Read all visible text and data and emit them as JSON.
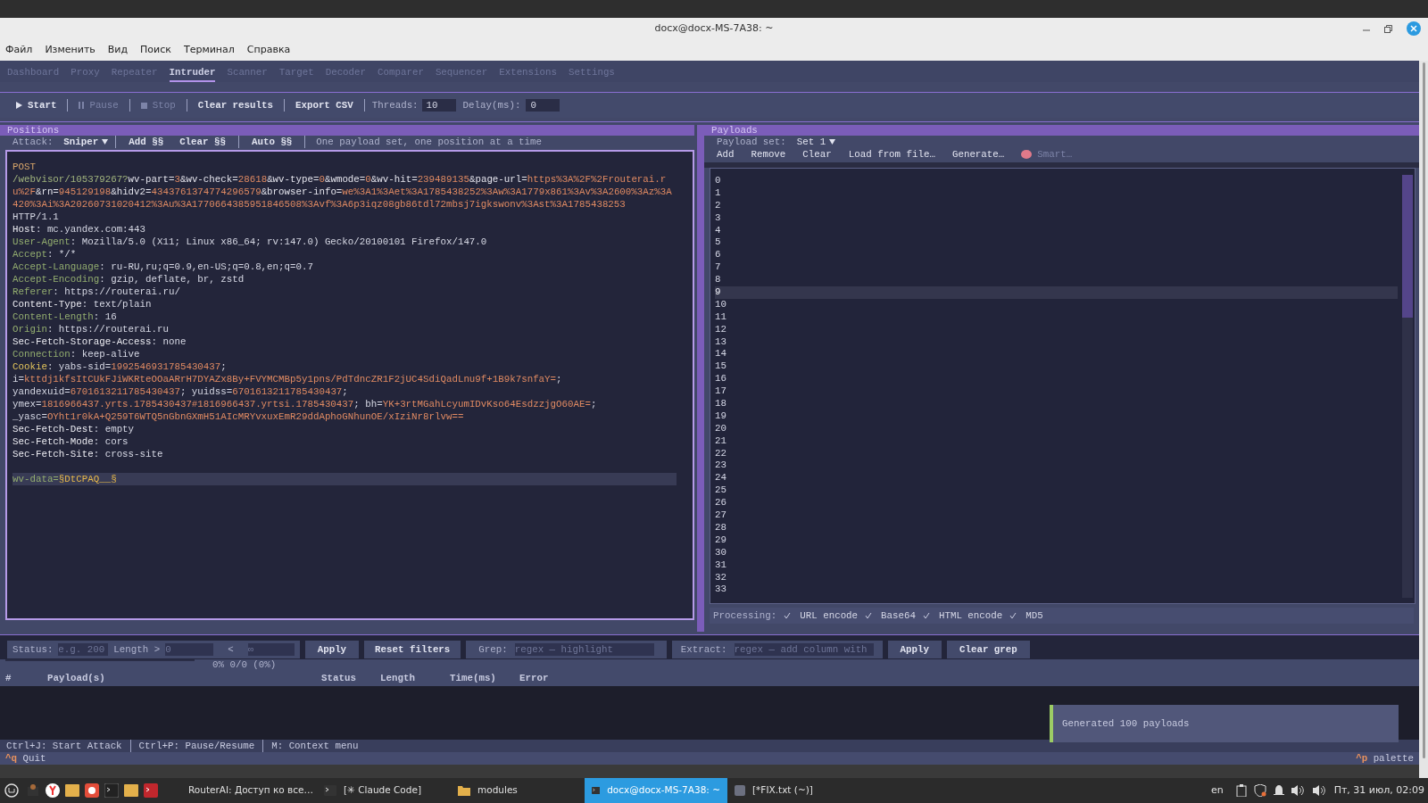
{
  "window": {
    "title": "docx@docx-MS-7A38: ~"
  },
  "menu": [
    "Файл",
    "Изменить",
    "Вид",
    "Поиск",
    "Терминал",
    "Справка"
  ],
  "tabs": [
    {
      "label": "Dashboard",
      "selected": false
    },
    {
      "label": "Proxy",
      "selected": false
    },
    {
      "label": "Repeater",
      "selected": false
    },
    {
      "label": "Intruder",
      "selected": true
    },
    {
      "label": "Scanner",
      "selected": false
    },
    {
      "label": "Target",
      "selected": false
    },
    {
      "label": "Decoder",
      "selected": false
    },
    {
      "label": "Comparer",
      "selected": false
    },
    {
      "label": "Sequencer",
      "selected": false
    },
    {
      "label": "Extensions",
      "selected": false
    },
    {
      "label": "Settings",
      "selected": false
    }
  ],
  "toolbar": {
    "buttons": [
      {
        "label": "Start",
        "kind": "play",
        "disabled": false
      },
      {
        "label": "Pause",
        "kind": "pause",
        "disabled": true
      },
      {
        "label": "Stop",
        "kind": "stop",
        "disabled": true
      },
      {
        "label": "Clear results",
        "disabled": false
      },
      {
        "label": "Export CSV",
        "disabled": false
      }
    ],
    "threads": {
      "label": "Threads:",
      "value": "10"
    },
    "delay": {
      "label": "Delay(ms):",
      "value": "0"
    }
  },
  "positions": {
    "title": "Positions",
    "attack_label": "Attack:",
    "attack_type": "Sniper",
    "buttons": [
      "Add §§",
      "Clear §§",
      "Auto §§"
    ],
    "hint": "One payload set, one position at a time",
    "lines": [
      {
        "current": false,
        "segments": [
          {
            "kind": "method",
            "text": "POST"
          }
        ]
      },
      {
        "current": false,
        "segments": [
          {
            "kind": "path",
            "text": "/webvisor/105379267?"
          },
          {
            "kind": "pname",
            "text": "wv-part="
          },
          {
            "kind": "pval",
            "text": "3"
          },
          {
            "kind": "pname",
            "text": "&wv-check="
          },
          {
            "kind": "pval",
            "text": "28618"
          },
          {
            "kind": "pname",
            "text": "&wv-type="
          },
          {
            "kind": "pval",
            "text": "0"
          },
          {
            "kind": "pname",
            "text": "&wmode="
          },
          {
            "kind": "pval",
            "text": "0"
          },
          {
            "kind": "pname",
            "text": "&wv-hit="
          },
          {
            "kind": "pval",
            "text": "239489135"
          },
          {
            "kind": "pname",
            "text": "&page-url="
          },
          {
            "kind": "pval",
            "text": "https%3A%2F%2Frouterai.ru%2F"
          },
          {
            "kind": "pname",
            "text": "&rn="
          },
          {
            "kind": "pval",
            "text": "945129198"
          },
          {
            "kind": "pname",
            "text": "&hidv2="
          },
          {
            "kind": "pval",
            "text": "4343761374774296579"
          },
          {
            "kind": "pname",
            "text": "&browser-info="
          },
          {
            "kind": "pval",
            "text": "we%3A1%3Aet%3A1785438252%3Aw%3A1779x861%3Av%3A2600%3Az%3A420%3Ai%3A20260731020412%3Au%3A1770664385951846508%3Avf%3A6p3iqz08gb86tdl72mbsj7igkswonv%3Ast%3A1785438253"
          }
        ]
      },
      {
        "current": false,
        "segments": [
          {
            "kind": "value",
            "text": "HTTP/1.1"
          }
        ]
      },
      {
        "current": false,
        "segments": [
          {
            "kind": "hname",
            "text": "Host"
          },
          {
            "kind": "value",
            "text": ": mc.yandex.com:443"
          }
        ]
      },
      {
        "current": false,
        "segments": [
          {
            "kind": "hstd",
            "text": "User-Agent"
          },
          {
            "kind": "value",
            "text": ": Mozilla/5.0 (X11; Linux x86_64; rv:147.0) Gecko/20100101 Firefox/147.0"
          }
        ]
      },
      {
        "current": false,
        "segments": [
          {
            "kind": "hstd",
            "text": "Accept"
          },
          {
            "kind": "value",
            "text": ": */*"
          }
        ]
      },
      {
        "current": false,
        "segments": [
          {
            "kind": "hstd",
            "text": "Accept-Language"
          },
          {
            "kind": "value",
            "text": ": ru-RU,ru;q=0.9,en-US;q=0.8,en;q=0.7"
          }
        ]
      },
      {
        "current": false,
        "segments": [
          {
            "kind": "hstd",
            "text": "Accept-Encoding"
          },
          {
            "kind": "value",
            "text": ": gzip, deflate, br, zstd"
          }
        ]
      },
      {
        "current": false,
        "segments": [
          {
            "kind": "hstd",
            "text": "Referer"
          },
          {
            "kind": "value",
            "text": ": https://routerai.ru/"
          }
        ]
      },
      {
        "current": false,
        "segments": [
          {
            "kind": "hname",
            "text": "Content-Type"
          },
          {
            "kind": "value",
            "text": ": text/plain"
          }
        ]
      },
      {
        "current": false,
        "segments": [
          {
            "kind": "hstd",
            "text": "Content-Length"
          },
          {
            "kind": "value",
            "text": ": 16"
          }
        ]
      },
      {
        "current": false,
        "segments": [
          {
            "kind": "hstd",
            "text": "Origin"
          },
          {
            "kind": "value",
            "text": ": https://routerai.ru"
          }
        ]
      },
      {
        "current": false,
        "segments": [
          {
            "kind": "hname",
            "text": "Sec-Fetch-Storage-Access"
          },
          {
            "kind": "value",
            "text": ": none"
          }
        ]
      },
      {
        "current": false,
        "segments": [
          {
            "kind": "hstd",
            "text": "Connection"
          },
          {
            "kind": "value",
            "text": ": keep-alive"
          }
        ]
      },
      {
        "current": false,
        "segments": [
          {
            "kind": "hcookie",
            "text": "Cookie"
          },
          {
            "kind": "value",
            "text": ": yabs-sid="
          },
          {
            "kind": "pval",
            "text": "1992546931785430437"
          },
          {
            "kind": "value",
            "text": ";"
          }
        ]
      },
      {
        "current": false,
        "segments": [
          {
            "kind": "value",
            "text": "i="
          },
          {
            "kind": "pval",
            "text": "kttdj1kfsItCUkFJiWKRteOOaARrH7DYAZx8By+FVYMCMBp5y1pns/PdTdncZR1F2jUC4SdiQadLnu9f+1B9k7snfaY="
          },
          {
            "kind": "value",
            "text": ";"
          }
        ]
      },
      {
        "current": false,
        "segments": [
          {
            "kind": "value",
            "text": "yandexuid="
          },
          {
            "kind": "pval",
            "text": "6701613211785430437"
          },
          {
            "kind": "value",
            "text": "; yuidss="
          },
          {
            "kind": "pval",
            "text": "6701613211785430437"
          },
          {
            "kind": "value",
            "text": ";"
          }
        ]
      },
      {
        "current": false,
        "segments": [
          {
            "kind": "value",
            "text": "ymex="
          },
          {
            "kind": "pval",
            "text": "1816966437.yrts.1785430437#1816966437.yrtsi.1785430437"
          },
          {
            "kind": "value",
            "text": "; bh="
          },
          {
            "kind": "pval",
            "text": "YK+3rtMGahLcyumIDvKso64EsdzzjgO60AE="
          },
          {
            "kind": "value",
            "text": ";"
          }
        ]
      },
      {
        "current": false,
        "segments": [
          {
            "kind": "value",
            "text": "_yasc="
          },
          {
            "kind": "pval",
            "text": "OYht1r0kA+Q259T6WTQ5nGbnGXmH51AIcMRYvxuxEmR29ddAphoGNhunOE/xIziNr8rlvw=="
          }
        ]
      },
      {
        "current": false,
        "segments": [
          {
            "kind": "hname",
            "text": "Sec-Fetch-Dest"
          },
          {
            "kind": "value",
            "text": ": empty"
          }
        ]
      },
      {
        "current": false,
        "segments": [
          {
            "kind": "hname",
            "text": "Sec-Fetch-Mode"
          },
          {
            "kind": "value",
            "text": ": cors"
          }
        ]
      },
      {
        "current": false,
        "segments": [
          {
            "kind": "hname",
            "text": "Sec-Fetch-Site"
          },
          {
            "kind": "value",
            "text": ": cross-site"
          }
        ]
      }
    ],
    "body": {
      "current": true,
      "segments": [
        {
          "kind": "hstd",
          "text": "wv-data="
        },
        {
          "kind": "marker",
          "text": "§DtCPAQ__§"
        }
      ]
    }
  },
  "payloads": {
    "title": "Payloads",
    "set_label": "Payload set:",
    "set_value": "Set 1",
    "actions": [
      {
        "label": "Add",
        "disabled": false
      },
      {
        "label": "Remove",
        "disabled": false
      },
      {
        "label": "Clear",
        "disabled": false
      },
      {
        "label": "Load from file…",
        "disabled": false
      },
      {
        "label": "Generate…",
        "disabled": false
      },
      {
        "label": "Smart…",
        "disabled": true,
        "kind": "brain"
      }
    ],
    "items": [
      {
        "label": "0",
        "selected": false
      },
      {
        "label": "1",
        "selected": false
      },
      {
        "label": "2",
        "selected": false
      },
      {
        "label": "3",
        "selected": false
      },
      {
        "label": "4",
        "selected": false
      },
      {
        "label": "5",
        "selected": false
      },
      {
        "label": "6",
        "selected": false
      },
      {
        "label": "7",
        "selected": false
      },
      {
        "label": "8",
        "selected": false
      },
      {
        "label": "9",
        "selected": true
      },
      {
        "label": "10",
        "selected": false
      },
      {
        "label": "11",
        "selected": false
      },
      {
        "label": "12",
        "selected": false
      },
      {
        "label": "13",
        "selected": false
      },
      {
        "label": "14",
        "selected": false
      },
      {
        "label": "15",
        "selected": false
      },
      {
        "label": "16",
        "selected": false
      },
      {
        "label": "17",
        "selected": false
      },
      {
        "label": "18",
        "selected": false
      },
      {
        "label": "19",
        "selected": false
      },
      {
        "label": "20",
        "selected": false
      },
      {
        "label": "21",
        "selected": false
      },
      {
        "label": "22",
        "selected": false
      },
      {
        "label": "23",
        "selected": false
      },
      {
        "label": "24",
        "selected": false
      },
      {
        "label": "25",
        "selected": false
      },
      {
        "label": "26",
        "selected": false
      },
      {
        "label": "27",
        "selected": false
      },
      {
        "label": "28",
        "selected": false
      },
      {
        "label": "29",
        "selected": false
      },
      {
        "label": "30",
        "selected": false
      },
      {
        "label": "31",
        "selected": false
      },
      {
        "label": "32",
        "selected": false
      },
      {
        "label": "33",
        "selected": false
      }
    ],
    "processing_label": "Processing:",
    "processing": [
      {
        "label": "URL encode",
        "checked": true
      },
      {
        "label": "Base64",
        "checked": true
      },
      {
        "label": "HTML encode",
        "checked": true
      },
      {
        "label": "MD5",
        "checked": true
      }
    ]
  },
  "filters": {
    "status_label": "Status:",
    "status_placeholder": "e.g. 200",
    "length_label": "Length >",
    "length_placeholder": "0",
    "lt_label": "<",
    "lt_placeholder": "∞",
    "apply": "Apply",
    "reset": "Reset filters",
    "grep_label": "Grep:",
    "grep_placeholder": "regex — highlight",
    "extract_label": "Extract:",
    "extract_placeholder": "regex — add column with",
    "apply2": "Apply",
    "clear_grep": "Clear grep"
  },
  "progress": {
    "level": 0,
    "text": "0% 0/0 (0%)"
  },
  "results": {
    "columns": [
      "#",
      "Payload(s)",
      "Status",
      "Length",
      "Time(ms)",
      "Error"
    ]
  },
  "shortcuts": [
    "Ctrl+J: Start Attack",
    "Ctrl+P: Pause/Resume",
    "M: Context menu"
  ],
  "footer": {
    "left_key": "^q",
    "left_label": "Quit",
    "right_key": "^p",
    "right_label": "palette"
  },
  "toast": "Generated 100 payloads",
  "taskbar": {
    "tasks": [
      {
        "label": "RouterAI: Доступ ко все…",
        "kind": "browser",
        "selected": false
      },
      {
        "label": "[✳ Claude Code]",
        "kind": "terminal",
        "selected": false
      },
      {
        "label": "modules",
        "kind": "folder",
        "selected": false
      },
      {
        "label": "docx@docx-MS-7A38: ~",
        "kind": "terminal",
        "selected": true
      },
      {
        "label": "[*FIX.txt (~)]",
        "kind": "editor",
        "selected": false
      }
    ],
    "lang": "en",
    "clock": "Пт, 31 июл, 02:09"
  }
}
